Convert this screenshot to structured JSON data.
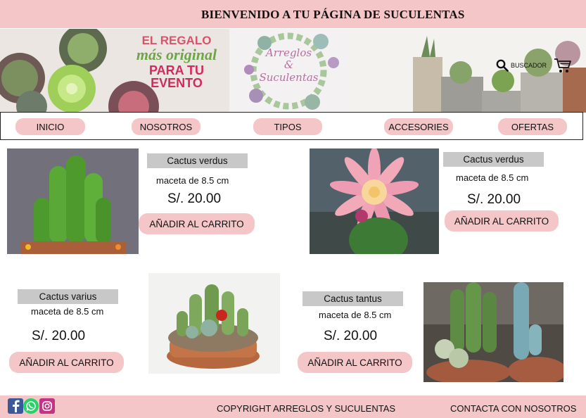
{
  "header": {
    "title": "BIENVENIDO A TU PÁGINA DE SUCULENTAS"
  },
  "banner": {
    "promo_line1": "EL REGALO",
    "promo_line2": "más original",
    "promo_line3": "PARA TU EVENTO",
    "logo_line1": "Arreglos",
    "logo_line2": "&",
    "logo_line3": "Suculentas",
    "search_label": "BUSCADOR"
  },
  "nav": {
    "items": [
      {
        "label": "INICIO"
      },
      {
        "label": "NOSOTROS"
      },
      {
        "label": "TIPOS"
      },
      {
        "label": "ACCESORIES"
      },
      {
        "label": "OFERTAS"
      }
    ]
  },
  "products": [
    {
      "name": "Cactus verdus",
      "size": "maceta de 8.5 cm",
      "price": "S/.  20.00",
      "button": "AÑADIR AL CARRITO"
    },
    {
      "name": "Cactus verdus",
      "size": "maceta de 8.5 cm",
      "price": "S/.  20.00",
      "button": "AÑADIR AL  CARRITO"
    },
    {
      "name": "Cactus varius",
      "size": "maceta de 8.5 cm",
      "price": "S/.  20.00",
      "button": "AÑADIR AL CARRITO"
    },
    {
      "name": "Cactus  tantus",
      "size": "maceta de 8.5 cm",
      "price": "S/.  20.00",
      "button": "AÑADIR AL CARRITO"
    }
  ],
  "footer": {
    "copyright": "COPYRIGHT ARREGLOS Y SUCULENTAS",
    "contact": "CONTACTA CON NOSOTROS",
    "social": [
      {
        "icon": "facebook-icon",
        "color": "#3b5998"
      },
      {
        "icon": "whatsapp-icon",
        "color": "#25d366"
      },
      {
        "icon": "instagram-icon",
        "color": "#c13584"
      }
    ]
  },
  "colors": {
    "accent_pink": "#f4c6c8",
    "label_gray": "#c8c8c8"
  }
}
